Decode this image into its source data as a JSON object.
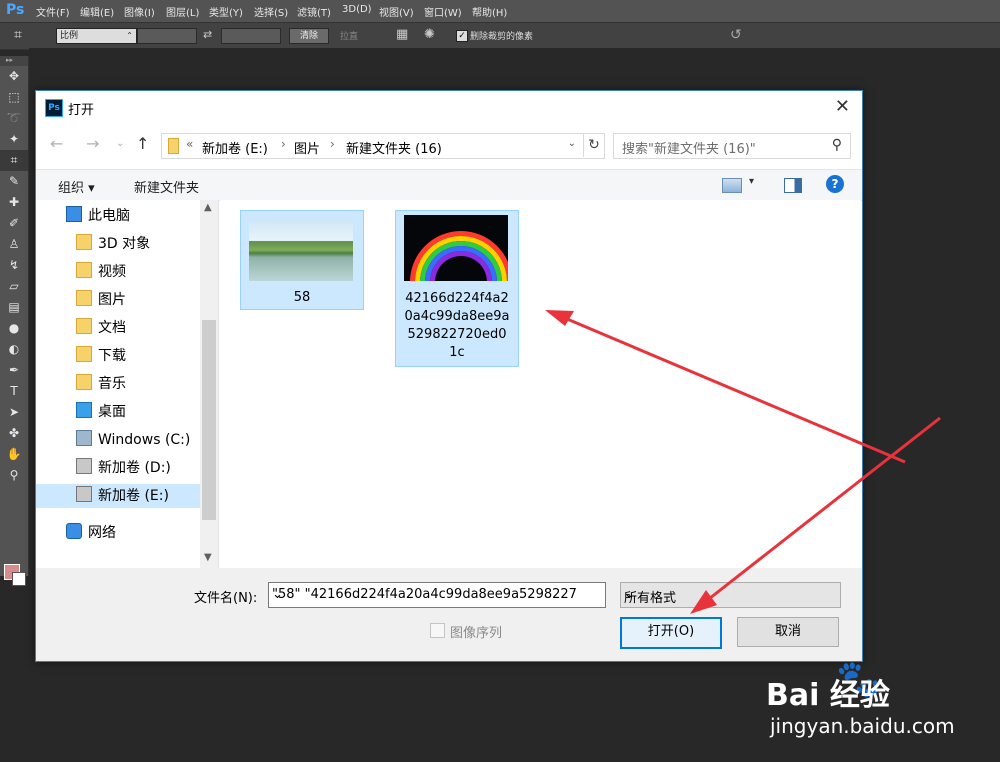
{
  "photoshop": {
    "logo": "Ps",
    "menus": [
      "文件(F)",
      "编辑(E)",
      "图像(I)",
      "图层(L)",
      "类型(Y)",
      "选择(S)",
      "滤镜(T)",
      "3D(D)",
      "视图(V)",
      "窗口(W)",
      "帮助(H)"
    ],
    "options": {
      "ratio_select": "比例",
      "clear_label": "清除",
      "straighten_label": "拉直",
      "delete_cropped_label": "删除裁剪的像素",
      "delete_cropped_checked": true
    }
  },
  "dialog": {
    "title": "打开",
    "address": {
      "overflow": "«",
      "crumbs": [
        "新加卷 (E:)",
        "图片",
        "新建文件夹 (16)"
      ]
    },
    "search_placeholder": "搜索\"新建文件夹 (16)\"",
    "toolbar": {
      "organize": "组织 ▾",
      "new_folder": "新建文件夹"
    },
    "nav": [
      {
        "label": "此电脑",
        "icon": "computer-icon"
      },
      {
        "label": "3D 对象",
        "icon": "3d-objects-icon"
      },
      {
        "label": "视频",
        "icon": "video-folder-icon"
      },
      {
        "label": "图片",
        "icon": "pictures-folder-icon"
      },
      {
        "label": "文档",
        "icon": "documents-folder-icon"
      },
      {
        "label": "下载",
        "icon": "downloads-folder-icon"
      },
      {
        "label": "音乐",
        "icon": "music-folder-icon"
      },
      {
        "label": "桌面",
        "icon": "desktop-folder-icon"
      },
      {
        "label": "Windows (C:)",
        "icon": "windows-drive-icon"
      },
      {
        "label": "新加卷 (D:)",
        "icon": "drive-icon"
      },
      {
        "label": "新加卷 (E:)",
        "icon": "drive-icon"
      },
      {
        "label": "网络",
        "icon": "network-icon"
      }
    ],
    "files": [
      {
        "name": "58"
      },
      {
        "name_lines": [
          "42166d224f4a2",
          "0a4c99da8ee9a",
          "529822720ed0",
          "1c"
        ]
      }
    ],
    "filename_label": "文件名(N):",
    "filename_value": "\"58\" \"42166d224f4a20a4c99da8ee9a5298227",
    "filetype_value": "所有格式",
    "image_sequence_label": "图像序列",
    "open_button": "打开(O)",
    "cancel_button": "取消"
  },
  "watermark": {
    "brand": "Bai  经验",
    "url": "jingyan.baidu.com"
  },
  "colors": {
    "accent": "#0078d7",
    "selection": "#cce8ff",
    "annotation_arrow": "#e8323c"
  }
}
